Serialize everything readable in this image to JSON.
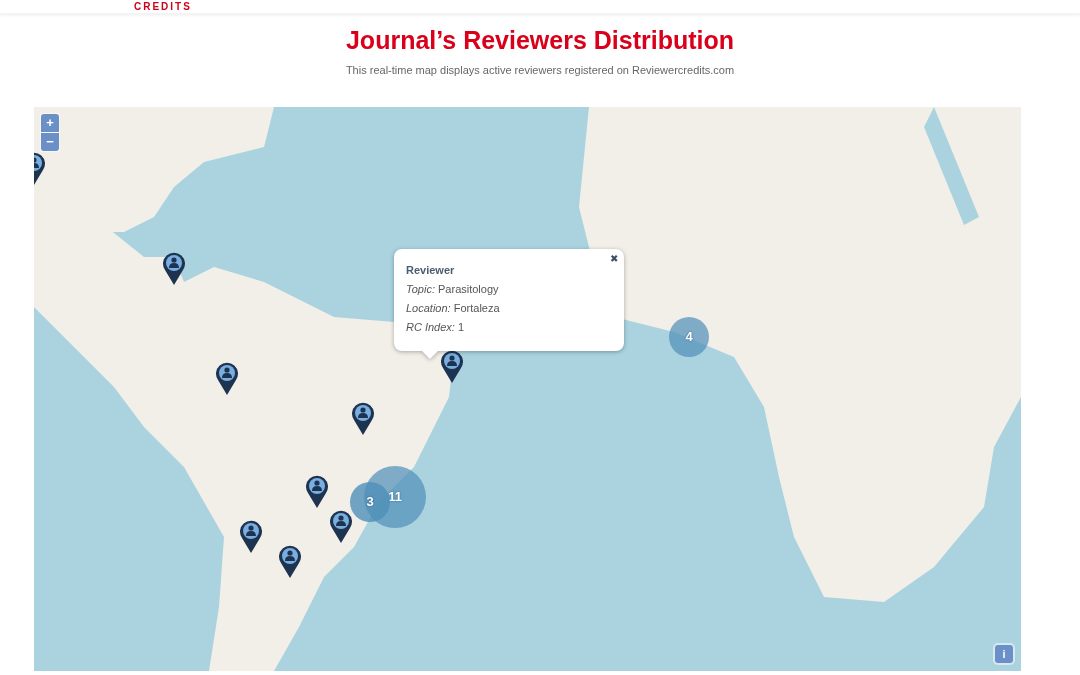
{
  "header": {
    "logo_text": "CREDITS"
  },
  "title": "Journal’s Reviewers Distribution",
  "subtitle": "This real-time map displays active reviewers registered on Reviewercredits.com",
  "map": {
    "zoom_in": "+",
    "zoom_out": "−",
    "info": "i",
    "clusters": [
      {
        "count": "3"
      },
      {
        "count": "11"
      },
      {
        "count": "4"
      }
    ],
    "popup": {
      "close": "✖",
      "heading": "Reviewer",
      "lines": [
        "*Topic:* Parasitology",
        "*Location:* Fortaleza",
        "*RC Index:* 1"
      ]
    }
  }
}
